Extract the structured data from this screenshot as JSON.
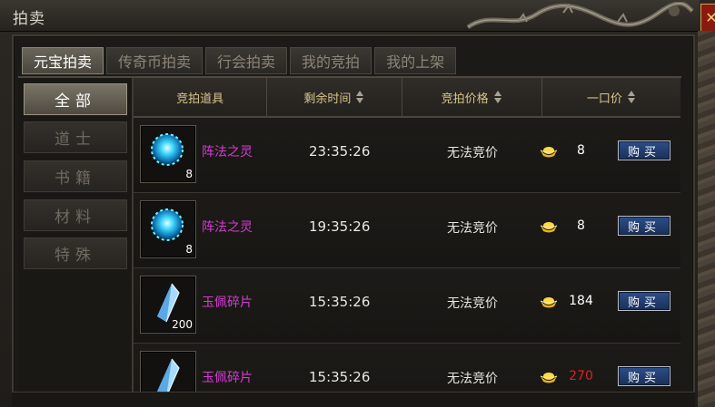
{
  "window": {
    "title": "拍卖",
    "close_glyph": "✕"
  },
  "tabs": [
    {
      "label": "元宝拍卖",
      "active": true
    },
    {
      "label": "传奇币拍卖",
      "active": false
    },
    {
      "label": "行会拍卖",
      "active": false
    },
    {
      "label": "我的竞拍",
      "active": false
    },
    {
      "label": "我的上架",
      "active": false
    }
  ],
  "categories": [
    {
      "label": "全部",
      "active": true
    },
    {
      "label": "道士",
      "active": false
    },
    {
      "label": "书籍",
      "active": false
    },
    {
      "label": "材料",
      "active": false
    },
    {
      "label": "特殊",
      "active": false
    }
  ],
  "columns": [
    {
      "label": "竞拍道具",
      "sortable": false
    },
    {
      "label": "剩余时间",
      "sortable": true
    },
    {
      "label": "竞拍价格",
      "sortable": true
    },
    {
      "label": "一口价",
      "sortable": true
    }
  ],
  "items": [
    {
      "name": "阵法之灵",
      "icon": "blue-orb-icon",
      "qty": "8",
      "time": "23:35:26",
      "bid": "无法竞价",
      "price": "8",
      "price_red": false,
      "buy": "购买"
    },
    {
      "name": "阵法之灵",
      "icon": "blue-orb-icon",
      "qty": "8",
      "time": "19:35:26",
      "bid": "无法竞价",
      "price": "8",
      "price_red": false,
      "buy": "购买"
    },
    {
      "name": "玉佩碎片",
      "icon": "crystal-shard-icon",
      "qty": "200",
      "time": "15:35:26",
      "bid": "无法竞价",
      "price": "184",
      "price_red": false,
      "buy": "购买"
    },
    {
      "name": "玉佩碎片",
      "icon": "crystal-shard-icon",
      "qty": "",
      "time": "15:35:26",
      "bid": "无法竞价",
      "price": "270",
      "price_red": true,
      "buy": "购买"
    }
  ],
  "colors": {
    "item_name": "#d23cd2",
    "header_text": "#d8c48a",
    "price_red": "#e02020",
    "buy_button": "#2c4f88"
  }
}
